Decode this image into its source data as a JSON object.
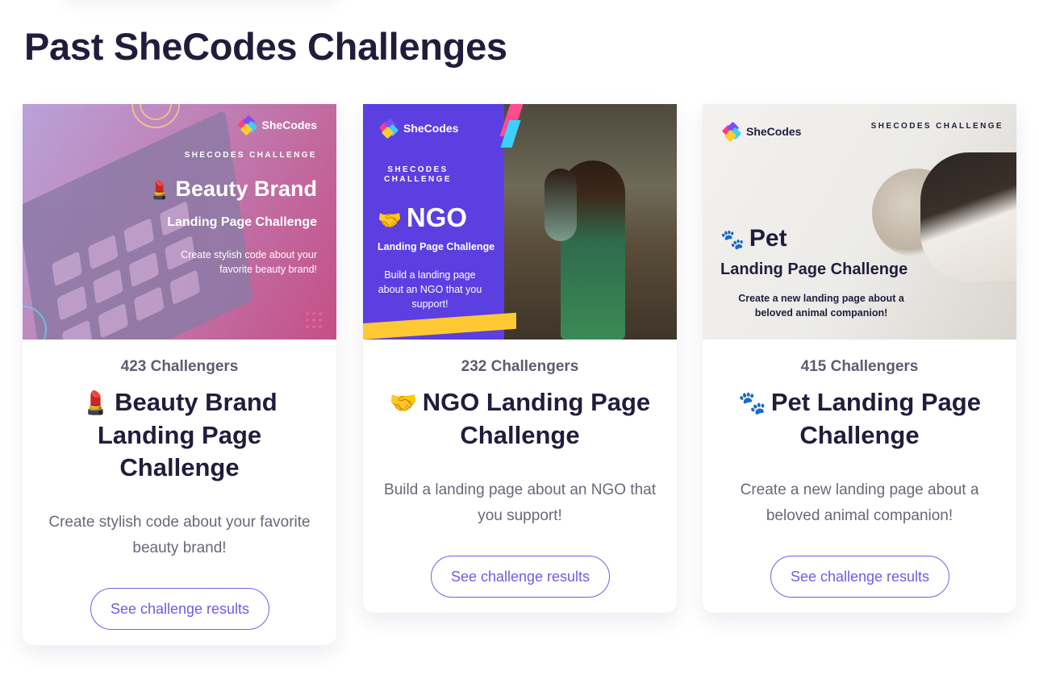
{
  "page": {
    "title": "Past SheCodes Challenges"
  },
  "colors": {
    "accent": "#7659e0",
    "title": "#201d3c",
    "muted": "#6a6779"
  },
  "cards": [
    {
      "challengers": "423 Challengers",
      "emoji": "💄",
      "title": "Beauty Brand Landing Page Challenge",
      "description": "Create stylish code about your favorite beauty brand!",
      "button": "See challenge results",
      "thumb": {
        "logo": "SheCodes",
        "eyebrow": "SHECODES CHALLENGE",
        "emoji": "💄",
        "title": "Beauty Brand",
        "subtitle": "Landing Page Challenge",
        "text": "Create stylish code about your favorite beauty brand!"
      }
    },
    {
      "challengers": "232 Challengers",
      "emoji": "🤝",
      "title": "NGO Landing Page Challenge",
      "description": "Build a landing page about an NGO that you support!",
      "button": "See challenge results",
      "thumb": {
        "logo": "SheCodes",
        "eyebrow": "SHECODES CHALLENGE",
        "emoji": "🤝",
        "title": "NGO",
        "subtitle": "Landing Page Challenge",
        "text": "Build a landing page about an NGO that you support!"
      }
    },
    {
      "challengers": "415 Challengers",
      "emoji": "🐾",
      "title": "Pet Landing Page Challenge",
      "description": "Create a new landing page about a beloved animal companion!",
      "button": "See challenge results",
      "thumb": {
        "logo": "SheCodes",
        "eyebrow": "SHECODES CHALLENGE",
        "emoji": "🐾",
        "title": "Pet",
        "subtitle": "Landing Page Challenge",
        "text": "Create a new landing page about a beloved animal companion!"
      }
    }
  ]
}
